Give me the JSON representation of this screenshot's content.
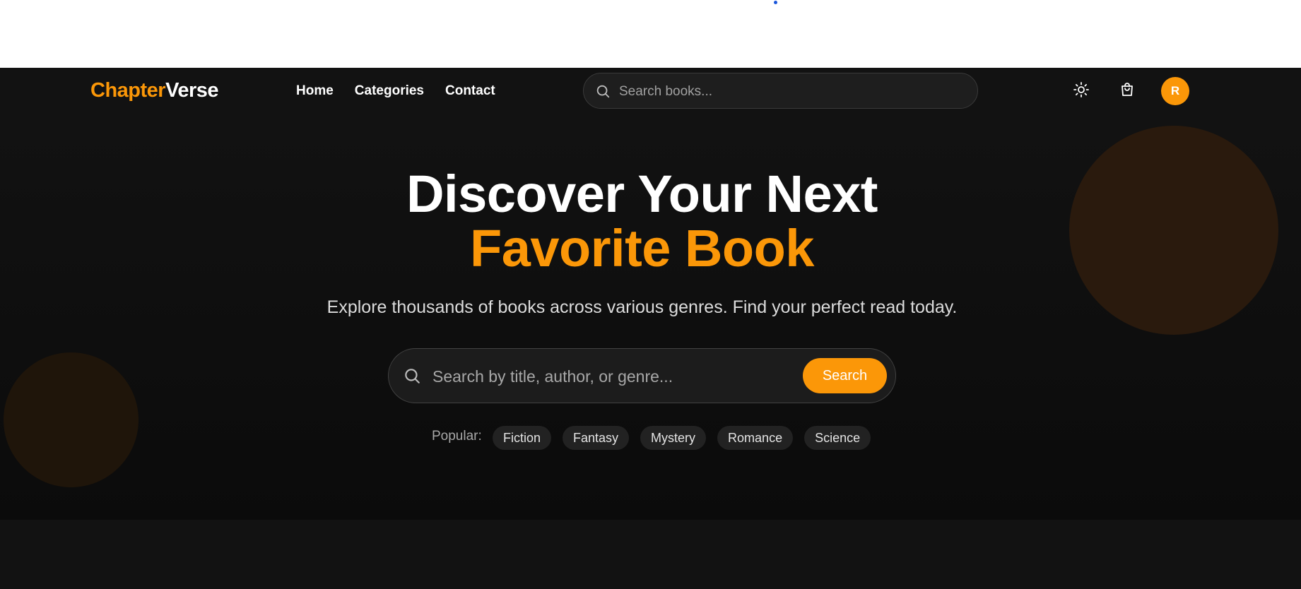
{
  "brand": {
    "part1": "Chapter",
    "part2": "Verse",
    "accent_color": "#fb9708"
  },
  "nav": {
    "links": [
      {
        "label": "Home"
      },
      {
        "label": "Categories"
      },
      {
        "label": "Contact"
      }
    ],
    "search": {
      "placeholder": "Search books...",
      "icon": "search-icon"
    },
    "actions": {
      "theme_icon": "sun-icon",
      "cart_icon": "shopping-bag-icon",
      "avatar_initial": "R"
    }
  },
  "hero": {
    "title_line1": "Discover Your Next",
    "title_line2": "Favorite Book",
    "subtitle": "Explore thousands of books across various genres. Find your perfect read today.",
    "search": {
      "placeholder": "Search by title, author, or genre...",
      "button_label": "Search",
      "icon": "search-icon"
    },
    "popular": {
      "label": "Popular:",
      "tags": [
        "Fiction",
        "Fantasy",
        "Mystery",
        "Romance",
        "Science"
      ]
    }
  },
  "colors": {
    "background": "#121212",
    "accent": "#fb9708",
    "text": "#ffffff"
  }
}
